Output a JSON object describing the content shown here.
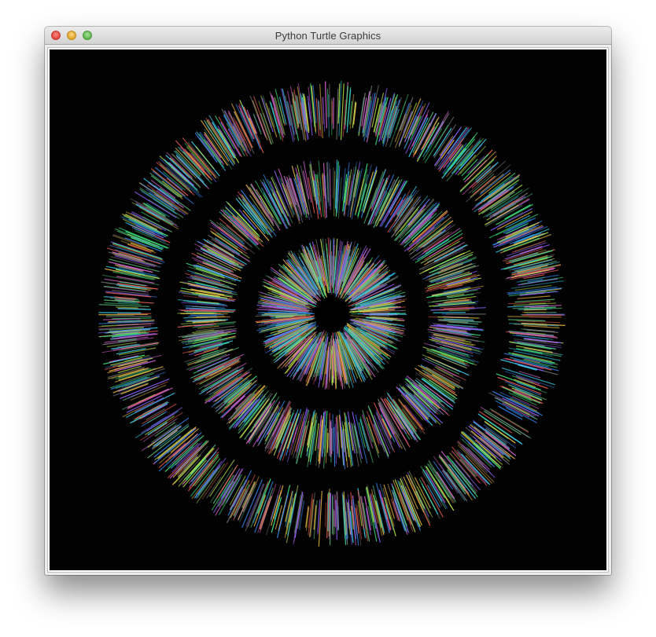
{
  "window": {
    "title": "Python Turtle Graphics",
    "controls": [
      "close",
      "minimize",
      "zoom"
    ]
  },
  "canvas": {
    "background": "#020202",
    "drawing": "concentric rings of multicolored radial line segments around a black center",
    "palette": [
      "#3fe07a",
      "#36c8e6",
      "#e25a4f",
      "#8a5cf0",
      "#e3b040",
      "#d05fc8",
      "#4fa36a",
      "#2f7fe0",
      "#b5e04a",
      "#6f6f6f"
    ]
  }
}
